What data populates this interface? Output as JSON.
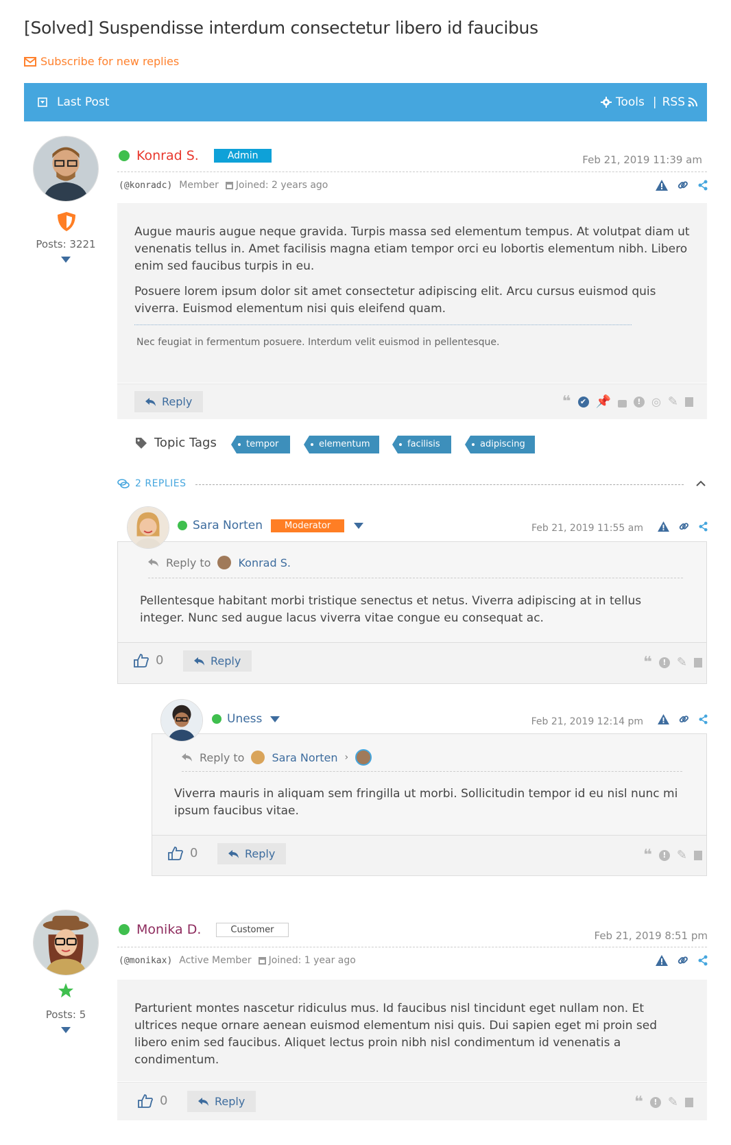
{
  "page": {
    "title": "[Solved] Suspendisse interdum consectetur libero id faucibus",
    "subscribe_label": "Subscribe for new replies"
  },
  "toolbar": {
    "last_post": "Last Post",
    "tools": "Tools",
    "separator": "|",
    "rss": "RSS"
  },
  "colors": {
    "accent": "#45a6de",
    "orange": "#ff812d",
    "online": "#3fbf4e",
    "admin": "#0ea1d8",
    "moderator": "#ff7e24",
    "link": "#3d6c9e"
  },
  "post1": {
    "author": "Konrad S.",
    "role_badge": "Admin",
    "date": "Feb 21, 2019 11:39 am",
    "handle": "(@konradc)",
    "rank": "Member",
    "joined": "Joined: 2 years ago",
    "posts": "Posts: 3221",
    "paragraphs": [
      "Augue mauris augue neque gravida. Turpis massa sed elementum tempus. At volutpat diam ut venenatis tellus in. Amet facilisis magna etiam tempor orci eu lobortis elementum nibh. Libero enim sed faucibus turpis in eu.",
      "Posuere lorem ipsum dolor sit amet consectetur adipiscing elit. Arcu cursus euismod quis viverra. Euismod elementum nisi quis eleifend quam."
    ],
    "signature": "Nec feugiat in fermentum posuere. Interdum velit euismod in pellentesque.",
    "reply_label": "Reply"
  },
  "topic_tags": {
    "label": "Topic Tags",
    "tags": [
      "tempor",
      "elementum",
      "facilisis",
      "adipiscing"
    ]
  },
  "replies_header": {
    "label": "2 REPLIES"
  },
  "reply1": {
    "author": "Sara Norten",
    "role_badge": "Moderator",
    "date": "Feb 21, 2019 11:55 am",
    "reply_to_label": "Reply to",
    "reply_to_name": "Konrad S.",
    "text": "Pellentesque habitant morbi tristique senectus et netus. Viverra adipiscing at in tellus integer. Nunc sed augue lacus viverra vitae congue eu consequat ac.",
    "likes": "0",
    "reply_label": "Reply"
  },
  "reply2": {
    "author": "Uness",
    "date": "Feb 21, 2019 12:14 pm",
    "reply_to_label": "Reply to",
    "reply_to_name": "Sara Norten",
    "text": "Viverra mauris in aliquam sem fringilla ut morbi. Sollicitudin tempor id eu nisl nunc mi ipsum faucibus vitae.",
    "likes": "0",
    "reply_label": "Reply"
  },
  "post2": {
    "author": "Monika D.",
    "role_badge": "Customer",
    "date": "Feb 21, 2019 8:51 pm",
    "handle": "(@monikax)",
    "rank": "Active Member",
    "joined": "Joined: 1 year ago",
    "posts": "Posts: 5",
    "text": "Parturient montes nascetur ridiculus mus. Id faucibus nisl tincidunt eget nullam non. Et ultrices neque ornare aenean euismod elementum nisi quis. Dui sapien eget mi proin sed libero enim sed faucibus. Aliquet lectus proin nibh nisl condimentum id venenatis a condimentum.",
    "likes": "0",
    "reply_label": "Reply"
  }
}
